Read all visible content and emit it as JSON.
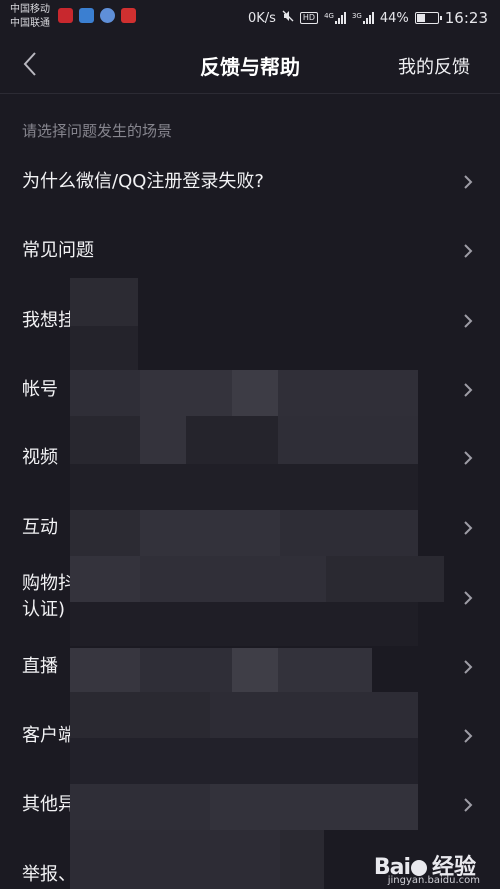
{
  "status_bar": {
    "carrier_1": "中国移动",
    "carrier_2": "中国联通",
    "net_speed": "0K/s",
    "hd": "HD",
    "net_4g": "4G",
    "net_3g": "3G",
    "battery": "44%",
    "battery_level": 0.44,
    "time": "16:23"
  },
  "nav": {
    "title": "反馈与帮助",
    "action": "我的反馈",
    "back_icon": "chevron-left-icon"
  },
  "section": {
    "header": "请选择问题发生的场景"
  },
  "items": [
    {
      "label": "为什么微信/QQ注册登录失败?"
    },
    {
      "label": "常见问题"
    },
    {
      "label": "我想挂"
    },
    {
      "label": "帐号"
    },
    {
      "label": "视频"
    },
    {
      "label": "互动"
    },
    {
      "label": "购物抖",
      "label_2": "认证)"
    },
    {
      "label": "直播"
    },
    {
      "label": "客户端"
    },
    {
      "label": "其他异"
    },
    {
      "label": "举报、"
    }
  ],
  "watermark": {
    "brand_left": "Bai",
    "brand_right": "经验",
    "url": "jingyan.baidu.com"
  }
}
